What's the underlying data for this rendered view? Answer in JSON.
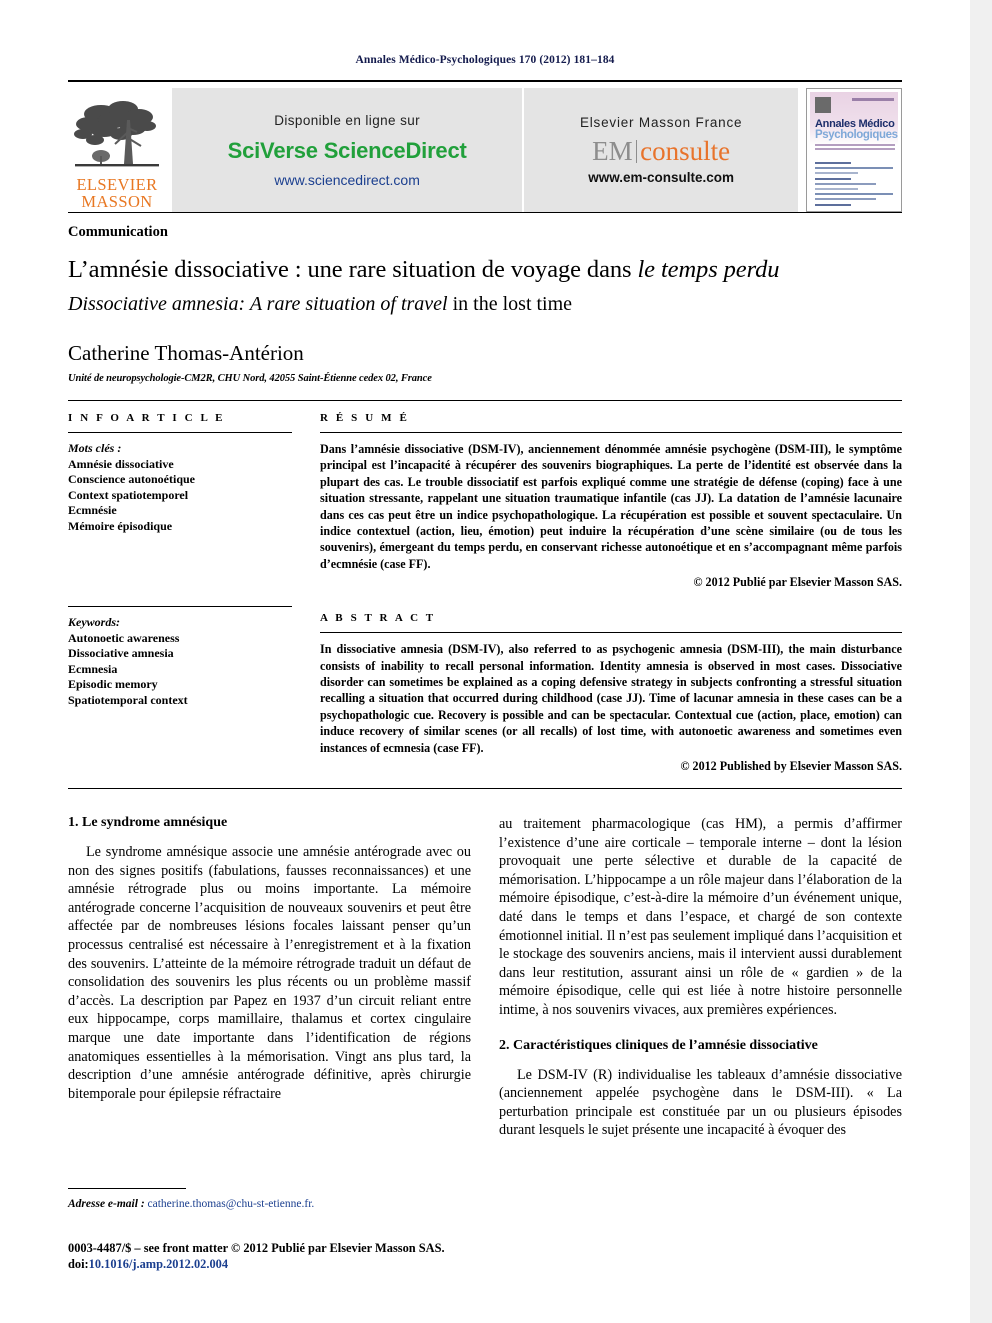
{
  "running_head": "Annales Médico-Psychologiques 170 (2012) 181–184",
  "banner": {
    "elsevier_line1": "ELSEVIER",
    "elsevier_line2": "MASSON",
    "sciencedirect": {
      "available_label": "Disponible en ligne sur",
      "brand": "SciVerse ScienceDirect",
      "url": "www.sciencedirect.com"
    },
    "emconsulte": {
      "publisher_label": "Elsevier Masson France",
      "brand_left": "EM",
      "brand_right": "consulte",
      "url": "www.em-consulte.com"
    },
    "cover": {
      "title_line1": "Annales Médico",
      "title_line2": "Psychologiques"
    }
  },
  "article": {
    "type_label": "Communication",
    "title_fr_roman": "L’amnésie dissociative : une rare situation de voyage dans ",
    "title_fr_italic": "le temps perdu",
    "title_en_italic": "Dissociative amnesia: A rare situation of travel ",
    "title_en_roman": "in the lost time",
    "author": "Catherine Thomas-Antérion",
    "affiliation": "Unité de neuropsychologie-CM2R, CHU Nord, 42055 Saint-Étienne cedex 02, France"
  },
  "info_article": {
    "heading": "I N F O  A R T I C L E",
    "keywords_fr_label": "Mots clés :",
    "keywords_fr": [
      "Amnésie dissociative",
      "Conscience autonoétique",
      "Context spatiotemporel",
      "Ecmnésie",
      "Mémoire épisodique"
    ],
    "keywords_en_label": "Keywords:",
    "keywords_en": [
      "Autonoetic awareness",
      "Dissociative amnesia",
      "Ecmnesia",
      "Episodic memory",
      "Spatiotemporal context"
    ]
  },
  "resume": {
    "heading": "R É S U M É",
    "text": "Dans l’amnésie dissociative (DSM-IV), anciennement dénommée amnésie psychogène (DSM-III), le symptôme principal est l’incapacité à récupérer des souvenirs biographiques. La perte de l’identité est observée dans la plupart des cas. Le trouble dissociatif est parfois expliqué comme une stratégie de défense (coping) face à une situation stressante, rappelant une situation traumatique infantile (cas JJ). La datation de l’amnésie lacunaire dans ces cas peut être un indice psychopathologique. La récupération est possible et souvent spectaculaire. Un indice contextuel (action, lieu, émotion) peut induire la récupération d’une scène similaire (ou de tous les souvenirs), émergeant du temps perdu, en conservant richesse autonoétique et en s’accompagnant même parfois d’ecmnésie (case FF).",
    "copyright": "© 2012 Publié par Elsevier Masson SAS."
  },
  "abstract": {
    "heading": "A B S T R A C T",
    "text": "In dissociative amnesia (DSM-IV), also referred to as psychogenic amnesia (DSM-III), the main disturbance consists of inability to recall personal information. Identity amnesia is observed in most cases. Dissociative disorder can sometimes be explained as a coping defensive strategy in subjects confronting a stressful situation recalling a situation that occurred during childhood (case JJ). Time of lacunar amnesia in these cases can be a psychopathologic cue. Recovery is possible and can be spectacular. Contextual cue (action, place, emotion) can induce recovery of similar scenes (or all recalls) of lost time, with autonoetic awareness and sometimes even instances of ecmnesia (case FF).",
    "copyright": "© 2012 Published by Elsevier Masson SAS."
  },
  "body": {
    "section1_heading": "1. Le syndrome amnésique",
    "section1_paragraph": "Le syndrome amnésique associe une amnésie antérograde avec ou non des signes positifs (fabulations, fausses reconnaissances) et une amnésie rétrograde plus ou moins importante. La mémoire antérograde concerne l’acquisition de nouveaux souvenirs et peut être affectée par de nombreuses lésions focales laissant penser qu’un processus centralisé est nécessaire à l’enregistrement et à la fixation des souvenirs. L’atteinte de la mémoire rétrograde traduit un défaut de consolidation des souvenirs les plus récents ou un problème massif d’accès. La description par Papez en 1937 d’un circuit reliant entre eux hippocampe, corps mamillaire, thalamus et cortex cingulaire marque une date importante dans l’identification de régions anatomiques essentielles à la mémorisation. Vingt ans plus tard, la description d’une amnésie antérograde définitive, après chirurgie bitemporale pour épilepsie réfractaire",
    "right_paragraph_cont": "au traitement pharmacologique (cas HM), a permis d’affirmer l’existence d’une aire corticale – temporale interne – dont la lésion provoquait une perte sélective et durable de la capacité de mémorisation. L’hippocampe a un rôle majeur dans l’élaboration de la mémoire épisodique, c’est-à-dire la mémoire d’un événement unique, daté dans le temps et dans l’espace, et chargé de son contexte émotionnel initial. Il n’est pas seulement impliqué dans l’acquisition et le stockage des souvenirs anciens, mais il intervient aussi durablement dans leur restitution, assurant ainsi un rôle de « gardien » de la mémoire épisodique, celle qui est liée à notre histoire personnelle intime, à nos souvenirs vivaces, aux premières expériences.",
    "section2_heading": "2. Caractéristiques cliniques de l’amnésie dissociative",
    "section2_paragraph": "Le DSM-IV (R) individualise les tableaux d’amnésie dissociative (anciennement appelée psychogène dans le DSM-III). « La perturbation principale est constituée par un ou plusieurs épisodes durant lesquels le sujet présente une incapacité à évoquer des"
  },
  "footnote": {
    "email_label": "Adresse e-mail :",
    "email": "catherine.thomas@chu-st-etienne.fr."
  },
  "footer": {
    "issn_line": "0003-4487/$ – see front matter © 2012 Publié par Elsevier Masson SAS.",
    "doi_label": "doi:",
    "doi": "10.1016/j.amp.2012.02.004"
  },
  "colors": {
    "runhead": "#141b4d",
    "sciencedirect_green": "#21a03b",
    "link_blue": "#1b3f8f",
    "elsevier_orange": "#e87722",
    "emconsulte_orange": "#e8732b",
    "banner_grey": "#e4e4e4"
  }
}
